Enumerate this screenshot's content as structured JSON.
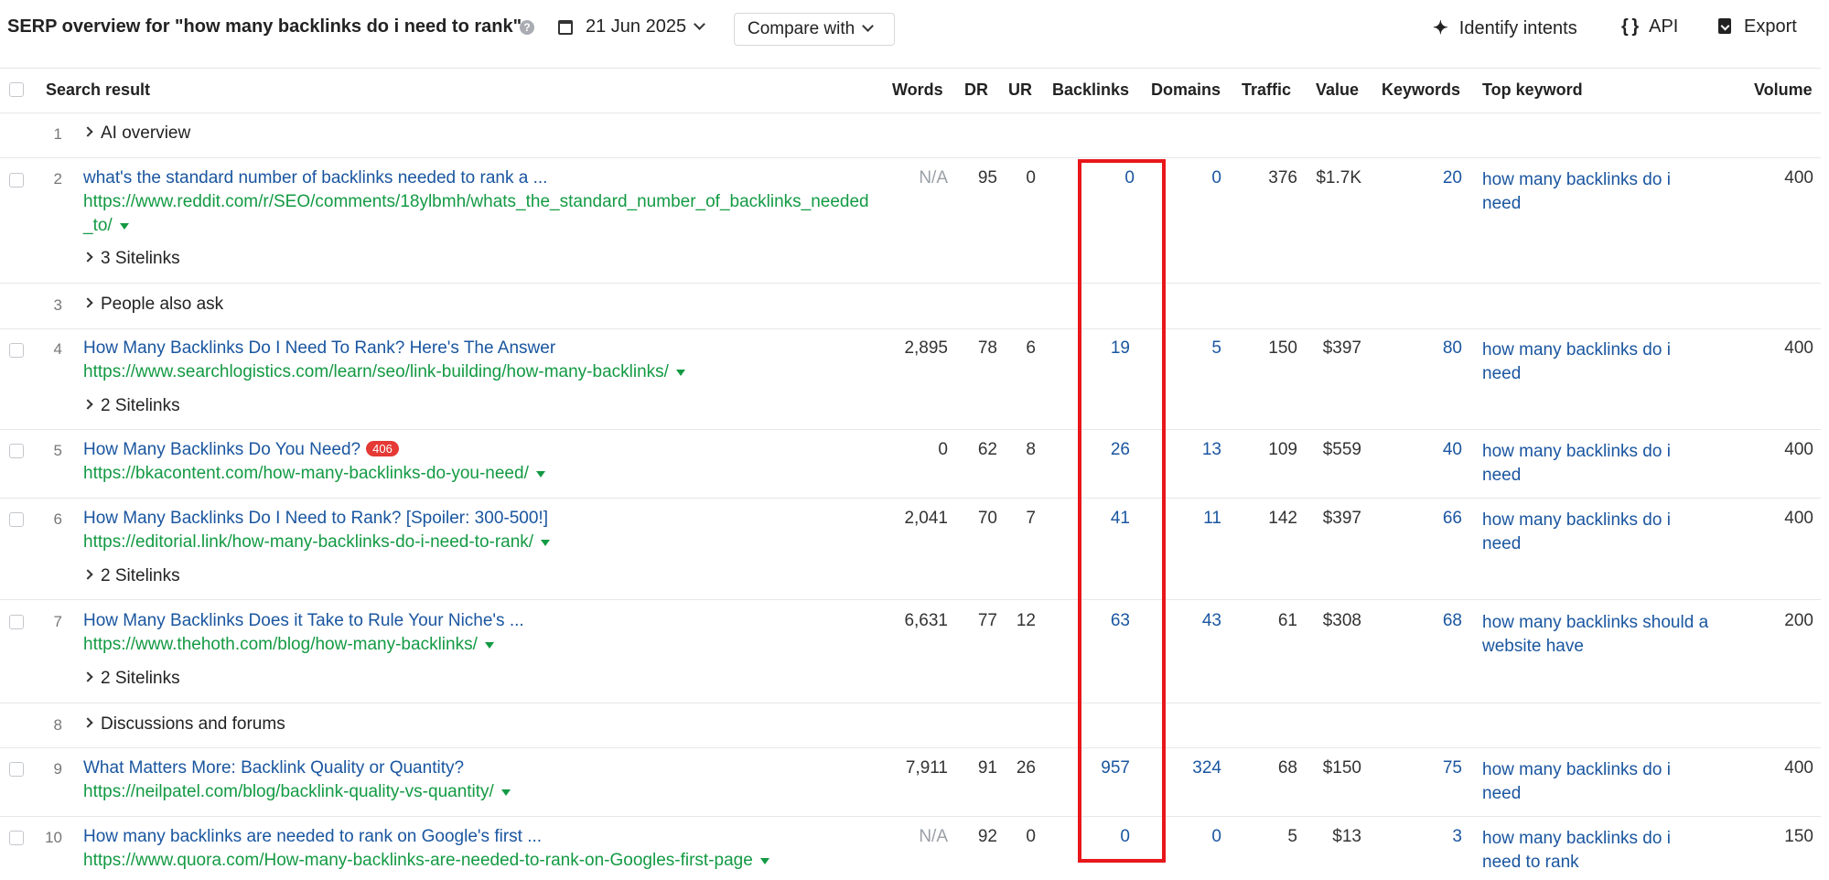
{
  "header": {
    "title": "SERP overview for \"how many backlinks do i need to rank\"",
    "date": "21 Jun 2025",
    "compare_label": "Compare with",
    "identify_label": "Identify intents",
    "api_label": "API",
    "export_label": "Export"
  },
  "columns": {
    "search_result": "Search result",
    "words": "Words",
    "dr": "DR",
    "ur": "UR",
    "backlinks": "Backlinks",
    "domains": "Domains",
    "traffic": "Traffic",
    "value": "Value",
    "keywords": "Keywords",
    "top_keyword": "Top keyword",
    "volume": "Volume"
  },
  "rows": [
    {
      "pos": "1",
      "feature": "AI overview"
    },
    {
      "pos": "2",
      "title": "what's the standard number of backlinks needed to rank a ...",
      "url": "https://www.reddit.com/r/SEO/comments/18ylbmh/whats_the_standard_number_of_backlinks_needed_to/",
      "sitelinks": "3 Sitelinks",
      "words": "N/A",
      "dr": "95",
      "ur": "0",
      "backlinks": "0",
      "domains": "0",
      "traffic": "376",
      "value": "$1.7K",
      "keywords": "20",
      "top_keyword": "how many backlinks do i need",
      "volume": "400"
    },
    {
      "pos": "3",
      "feature": "People also ask"
    },
    {
      "pos": "4",
      "title": "How Many Backlinks Do I Need To Rank? Here's The Answer",
      "url": "https://www.searchlogistics.com/learn/seo/link-building/how-many-backlinks/",
      "sitelinks": "2 Sitelinks",
      "words": "2,895",
      "dr": "78",
      "ur": "6",
      "backlinks": "19",
      "domains": "5",
      "traffic": "150",
      "value": "$397",
      "keywords": "80",
      "top_keyword": "how many backlinks do i need",
      "volume": "400"
    },
    {
      "pos": "5",
      "title": "How Many Backlinks Do You Need?",
      "badge": "406",
      "url": "https://bkacontent.com/how-many-backlinks-do-you-need/",
      "words": "0",
      "dr": "62",
      "ur": "8",
      "backlinks": "26",
      "domains": "13",
      "traffic": "109",
      "value": "$559",
      "keywords": "40",
      "top_keyword": "how many backlinks do i need",
      "volume": "400"
    },
    {
      "pos": "6",
      "title": "How Many Backlinks Do I Need to Rank? [Spoiler: 300-500!]",
      "url": "https://editorial.link/how-many-backlinks-do-i-need-to-rank/",
      "sitelinks": "2 Sitelinks",
      "words": "2,041",
      "dr": "70",
      "ur": "7",
      "backlinks": "41",
      "domains": "11",
      "traffic": "142",
      "value": "$397",
      "keywords": "66",
      "top_keyword": "how many backlinks do i need",
      "volume": "400"
    },
    {
      "pos": "7",
      "title": "How Many Backlinks Does it Take to Rule Your Niche's ...",
      "url": "https://www.thehoth.com/blog/how-many-backlinks/",
      "sitelinks": "2 Sitelinks",
      "words": "6,631",
      "dr": "77",
      "ur": "12",
      "backlinks": "63",
      "domains": "43",
      "traffic": "61",
      "value": "$308",
      "keywords": "68",
      "top_keyword": "how many backlinks should a website have",
      "volume": "200"
    },
    {
      "pos": "8",
      "feature": "Discussions and forums"
    },
    {
      "pos": "9",
      "title": "What Matters More: Backlink Quality or Quantity?",
      "url": "https://neilpatel.com/blog/backlink-quality-vs-quantity/",
      "words": "7,911",
      "dr": "91",
      "ur": "26",
      "backlinks": "957",
      "domains": "324",
      "traffic": "68",
      "value": "$150",
      "keywords": "75",
      "top_keyword": "how many backlinks do i need",
      "volume": "400"
    },
    {
      "pos": "10",
      "title": "How many backlinks are needed to rank on Google's first ...",
      "url": "https://www.quora.com/How-many-backlinks-are-needed-to-rank-on-Googles-first-page",
      "words": "N/A",
      "dr": "92",
      "ur": "0",
      "backlinks": "0",
      "domains": "0",
      "traffic": "5",
      "value": "$13",
      "keywords": "3",
      "top_keyword": "how many backlinks do i need to rank",
      "volume": "150"
    }
  ],
  "colors": {
    "link": "#1a56a0",
    "url": "#139a43",
    "highlight": "#e8171b",
    "badge": "#e53935"
  }
}
